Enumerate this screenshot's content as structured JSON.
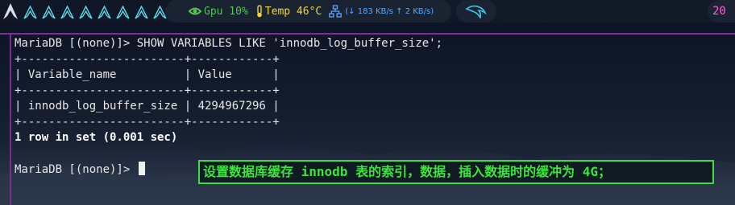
{
  "statusbar": {
    "workspaces": [
      "A",
      "A",
      "A",
      "A",
      "A",
      "A",
      "A",
      "A",
      "A"
    ],
    "gpu_label": "Gpu 10%",
    "temp_label": "Temp 46°C",
    "net_label": "(↓ 183 KB/s ↑ 2 KB/s)",
    "clock_partial": "20",
    "colors": {
      "gpu": "#52c552",
      "temp": "#f2d43a",
      "net": "#58a6ff",
      "clock": "#ff5fd2",
      "border": "#7d2a9b"
    }
  },
  "terminal": {
    "lines": [
      "MariaDB [(none)]> SHOW VARIABLES LIKE 'innodb_log_buffer_size';",
      "+------------------------+------------+",
      "| Variable_name          | Value      |",
      "+------------------------+------------+",
      "| innodb_log_buffer_size | 4294967296 |",
      "+------------------------+------------+"
    ],
    "result_summary": "1 row in set (0.001 sec)",
    "prompt": "MariaDB [(none)]> "
  },
  "annotation": {
    "text": "设置数据库缓存 innodb 表的索引，数据，插入数据时的缓冲为 4G；",
    "color": "#39e639"
  }
}
